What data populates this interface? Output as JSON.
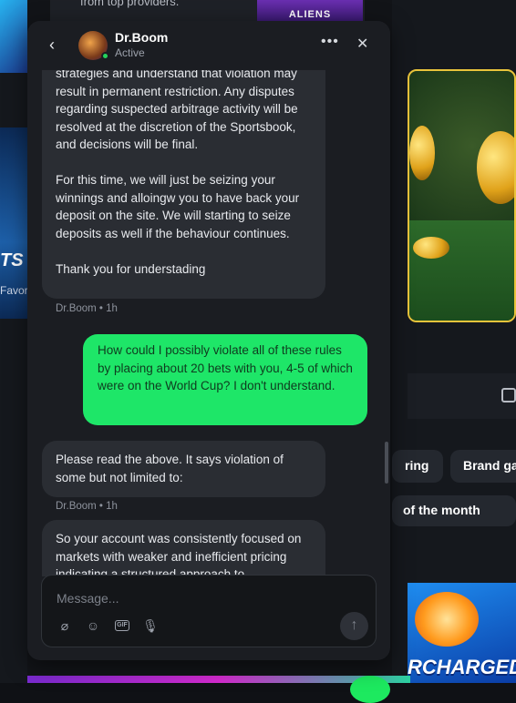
{
  "background": {
    "top_left_caption": "from top providers.",
    "promo_game_title": "ALIENS",
    "left_tile_text": "TS",
    "left_tile_sub": "Favor",
    "pill_a": "ring",
    "pill_b": "Brand ga",
    "pill_c": "of the month",
    "bottom_game_title": "RCHARGED"
  },
  "chat": {
    "header": {
      "back_icon": "chevron-left-icon",
      "name": "Dr.Boom",
      "status": "Active",
      "more_icon": "ellipsis-icon",
      "more_glyph": "•••",
      "close_glyph": "✕"
    },
    "messages": [
      {
        "from": "agent",
        "paragraphs": [
          "strategies and understand that violation may result in permanent restriction. Any disputes regarding suspected arbitrage activity will be resolved at the discretion of the Sportsbook, and decisions will be final.",
          "For this time, we will just be seizing your winnings and alloingw you to have back your deposit on the site. We will starting to seize deposits as well if the behaviour continues.",
          "Thank you for understading"
        ],
        "meta": "Dr.Boom • 1h"
      },
      {
        "from": "user",
        "text": "How could I possibly violate all of these rules by placing about 20 bets with you, 4-5 of which were on the World Cup? I don't understand."
      },
      {
        "from": "agent",
        "text": "Please read the above. It says violation of some but not limited to:",
        "meta": "Dr.Boom • 1h"
      },
      {
        "from": "agent",
        "text": "So your account was consistently focused on markets with weaker and inefficient pricing indicating a structured approach to"
      }
    ],
    "composer": {
      "placeholder": "Message...",
      "attach_glyph": "⌀",
      "emoji_glyph": "☺",
      "gif_label": "GIF",
      "mic_glyph": "🎙",
      "send_glyph": "↑",
      "jump_glyph": "⌄"
    }
  },
  "colors": {
    "accent_green": "#1ee668",
    "panel": "#1b1d22",
    "bubble": "#2a2d33"
  }
}
